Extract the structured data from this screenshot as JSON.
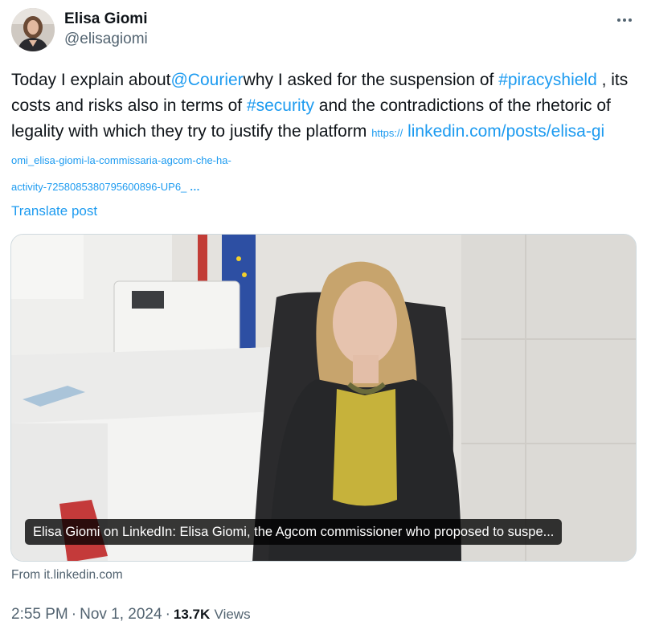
{
  "author": {
    "display_name": "Elisa Giomi",
    "handle": "@elisagiomi"
  },
  "tweet": {
    "text_1": "Today I explain about",
    "mention": "@Courier",
    "text_2": "why I asked for the suspension of ",
    "hashtag_1": "#piracyshield",
    "text_3": " , its costs and risks also in terms of ",
    "hashtag_2": "#security",
    "text_4": " and the contradictions of the rhetoric of legality with which they try to justify the platform ",
    "url_proto": "https://",
    "url_main": "linkedin.com/posts/elisa-gi",
    "url_rest": "omi_elisa-giomi-la-commissaria-agcom-che-ha-",
    "url_line2": "activity-7258085380795600896-UP6_",
    "url_ellipsis": "…",
    "translate_label": "Translate post"
  },
  "card": {
    "caption": "Elisa Giomi on LinkedIn: Elisa Giomi, the Agcom commissioner who proposed to suspe...",
    "source": "From it.linkedin.com"
  },
  "meta": {
    "time": "2:55 PM",
    "date": "Nov 1, 2024",
    "separator": "·",
    "views_count": "13.7K",
    "views_label": "Views"
  },
  "icons": {
    "more": "more-dots-icon"
  },
  "colors": {
    "link": "#1d9bf0",
    "text": "#0f1419",
    "secondary": "#536471"
  }
}
